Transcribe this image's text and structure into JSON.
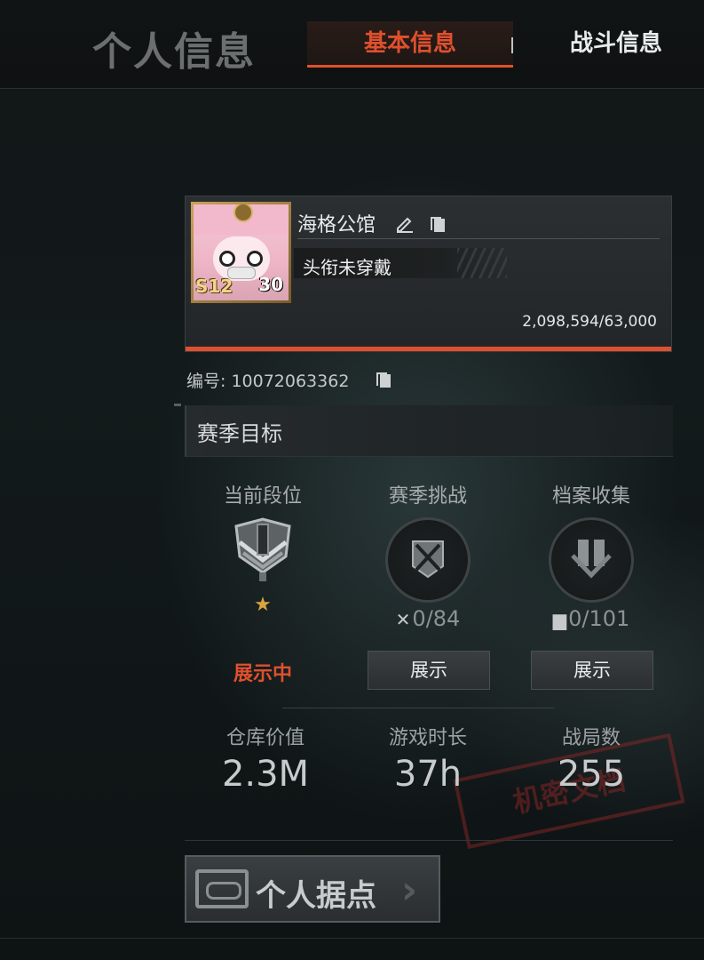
{
  "header": {
    "title": "个人信息",
    "tabs": [
      {
        "label": "基本信息",
        "active": true
      },
      {
        "label": "战斗信息",
        "active": false
      }
    ],
    "accent_color": "#e0502e"
  },
  "profile": {
    "nickname": "海格公馆",
    "title": "头衔未穿戴",
    "level": "30",
    "season_badge": "S12",
    "experience": "2,098,594/63,000",
    "id_label": "编号: 10072063362"
  },
  "season_goals": {
    "title": "赛季目标",
    "items": [
      {
        "label": "当前段位",
        "status": "展示中",
        "star": "★"
      },
      {
        "label": "赛季挑战",
        "progress": "0/84",
        "progress_icon": "crossed-swords-icon",
        "button": "展示"
      },
      {
        "label": "档案收集",
        "progress": "0/101",
        "progress_icon": "folder-icon",
        "button": "展示"
      }
    ]
  },
  "stats": [
    {
      "label": "仓库价值",
      "value": "2.3M"
    },
    {
      "label": "游戏时长",
      "value": "37h"
    },
    {
      "label": "战局数",
      "value": "255"
    }
  ],
  "base_button": {
    "label": "个人据点"
  },
  "stamp_text": "机密文档"
}
